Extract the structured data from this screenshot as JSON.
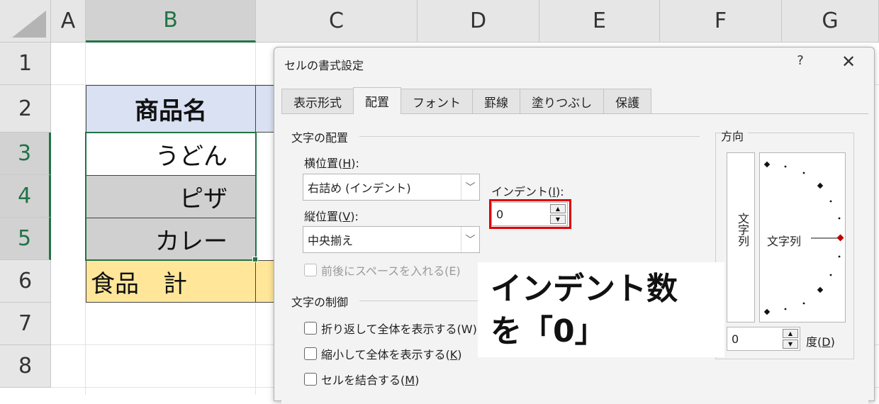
{
  "spreadsheet": {
    "columns": [
      "A",
      "B",
      "C",
      "D",
      "E",
      "F",
      "G"
    ],
    "rows": [
      "1",
      "2",
      "3",
      "4",
      "5",
      "6",
      "7",
      "8"
    ],
    "cells": {
      "B2": "商品名",
      "B3": "うどん",
      "B4": "ピザ",
      "B5": "カレー",
      "B6": "食品　計"
    }
  },
  "dialog": {
    "title": "セルの書式設定",
    "help": "?",
    "close": "✕",
    "tabs": [
      "表示形式",
      "配置",
      "フォント",
      "罫線",
      "塗りつぶし",
      "保護"
    ],
    "active_tab": "配置",
    "text_alignment": {
      "group_title": "文字の配置",
      "horizontal_label": "横位置(",
      "horizontal_key": "H",
      "horizontal_label_end": "):",
      "horizontal_value": "右詰め (インデント)",
      "vertical_label": "縦位置(",
      "vertical_key": "V",
      "vertical_label_end": "):",
      "vertical_value": "中央揃え",
      "indent_label": "インデント(",
      "indent_key": "I",
      "indent_label_end": "):",
      "indent_value": "0",
      "justify_distributed": "前後にスペースを入れる(E)"
    },
    "text_control": {
      "group_title": "文字の制御",
      "wrap_text": "折り返して全体を表示する(W)",
      "shrink_label": "縮小して全体を表示する(",
      "shrink_key": "K",
      "shrink_end": ")",
      "merge_label": "セルを結合する(",
      "merge_key": "M",
      "merge_end": ")"
    },
    "orientation": {
      "group_title": "方向",
      "vertical_text": "文字列",
      "dial_text": "文字列",
      "degrees_value": "0",
      "degrees_label": "度(",
      "degrees_key": "D",
      "degrees_end": ")"
    }
  },
  "callout": {
    "line1": "インデント数",
    "line2": "を「0」"
  },
  "colors": {
    "excel_green": "#217346",
    "header_blue": "#d9e1f2",
    "total_yellow": "#ffe699",
    "highlight_red": "#e00000"
  }
}
